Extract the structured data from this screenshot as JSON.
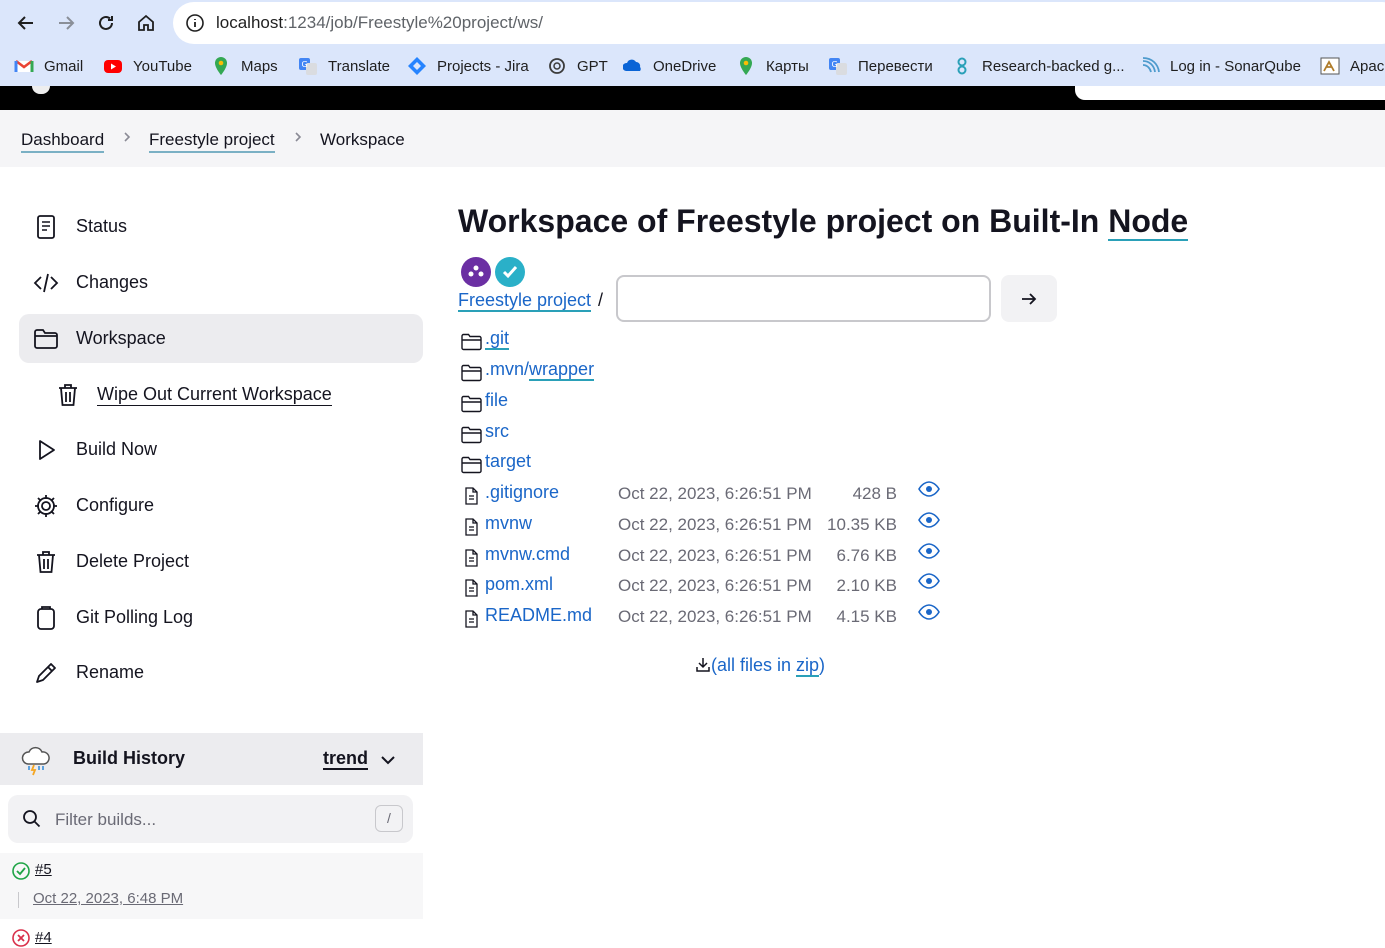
{
  "browser": {
    "url_host": "localhost",
    "url_rest": ":1234/job/Freestyle%20project/ws/",
    "bookmarks": [
      "Gmail",
      "YouTube",
      "Maps",
      "Translate",
      "Projects - Jira",
      "GPT",
      "OneDrive",
      "Карты",
      "Перевести",
      "Research-backed g...",
      "Log in - SonarQube",
      "Apac"
    ]
  },
  "breadcrumb": {
    "items": [
      "Dashboard",
      "Freestyle project",
      "Workspace"
    ]
  },
  "sidebar": {
    "items": [
      {
        "label": "Status",
        "icon": "document-icon"
      },
      {
        "label": "Changes",
        "icon": "code-icon"
      },
      {
        "label": "Workspace",
        "icon": "folder-icon"
      },
      {
        "label": "Wipe Out Current Workspace",
        "icon": "trash-icon"
      },
      {
        "label": "Build Now",
        "icon": "play-icon"
      },
      {
        "label": "Configure",
        "icon": "gear-icon"
      },
      {
        "label": "Delete Project",
        "icon": "trash-icon"
      },
      {
        "label": "Git Polling Log",
        "icon": "clipboard-icon"
      },
      {
        "label": "Rename",
        "icon": "pencil-icon"
      }
    ]
  },
  "history": {
    "title": "Build History",
    "trend_label": "trend",
    "filter_placeholder": "Filter builds...",
    "shortcut": "/",
    "builds": [
      {
        "number": "#5",
        "date": "Oct 22, 2023, 6:48 PM",
        "status": "success"
      },
      {
        "number": "#4",
        "status": "failed"
      }
    ]
  },
  "main": {
    "title_prefix": "Workspace of Freestyle project on Built-In ",
    "title_node": "Node",
    "path_root": "Freestyle project",
    "path_sep": "/",
    "folders": [
      {
        "name": ".git"
      },
      {
        "name": ".mvn",
        "child": "wrapper"
      },
      {
        "name": "file"
      },
      {
        "name": "src"
      },
      {
        "name": "target"
      }
    ],
    "files": [
      {
        "name": ".gitignore",
        "date": "Oct 22, 2023, 6:26:51 PM",
        "size": "428 B"
      },
      {
        "name": "mvnw",
        "date": "Oct 22, 2023, 6:26:51 PM",
        "size": "10.35 KB"
      },
      {
        "name": "mvnw.cmd",
        "date": "Oct 22, 2023, 6:26:51 PM",
        "size": "6.76 KB"
      },
      {
        "name": "pom.xml",
        "date": "Oct 22, 2023, 6:26:51 PM",
        "size": "2.10 KB"
      },
      {
        "name": "README.md",
        "date": "Oct 22, 2023, 6:26:51 PM",
        "size": "4.15 KB"
      }
    ],
    "zip_prefix": "(all files in ",
    "zip_word": "zip",
    "zip_suffix": ")"
  },
  "colors": {
    "link": "#1a66c8",
    "underline": "#2aa0b8",
    "active_bg": "#ececef",
    "chrome_bg": "#dbe6fb"
  }
}
